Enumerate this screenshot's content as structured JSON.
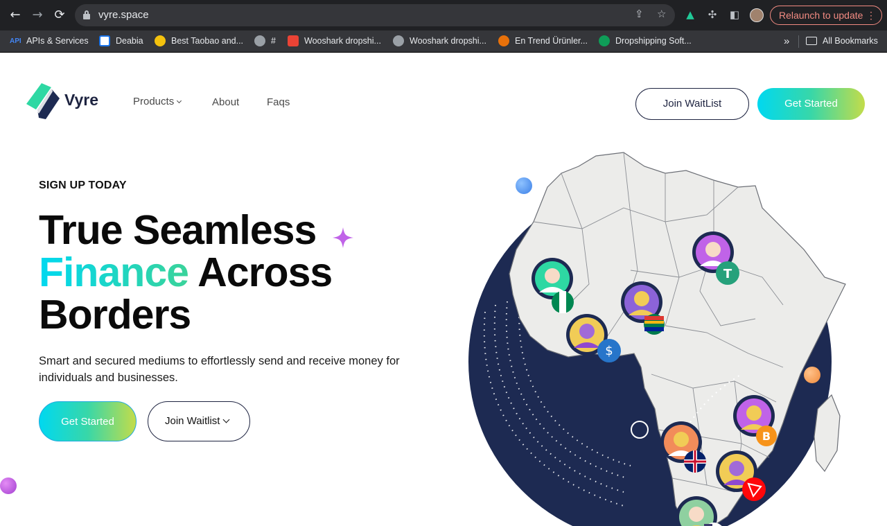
{
  "browser": {
    "url": "vyre.space",
    "relaunch_label": "Relaunch to update",
    "bookmarks": [
      {
        "label": "APIs & Services",
        "color": "#4285f4"
      },
      {
        "label": "Deabia",
        "color": "#ffffff"
      },
      {
        "label": "Best Taobao and...",
        "color": "#f4c20d"
      },
      {
        "label": "#",
        "color": "#9aa0a6"
      },
      {
        "label": "Wooshark dropshi...",
        "color": "#ea4335"
      },
      {
        "label": "Wooshark dropshi...",
        "color": "#9aa0a6"
      },
      {
        "label": "En Trend Ürünler...",
        "color": "#e8710a"
      },
      {
        "label": "Dropshipping Soft...",
        "color": "#0f9d58"
      }
    ],
    "overflow_label": "»",
    "all_bookmarks_label": "All Bookmarks"
  },
  "header": {
    "logo_text": "Vyre",
    "nav": {
      "products": "Products",
      "about": "About",
      "faqs": "Faqs"
    },
    "join_waitlist_label": "Join WaitList",
    "get_started_label": "Get Started"
  },
  "hero": {
    "eyebrow": "SIGN UP TODAY",
    "headline_line1": "True Seamless",
    "headline_accent": "Finance",
    "headline_line2_rest": " Across",
    "headline_line3": "Borders",
    "subtext": "Smart and secured mediums to effortlessly send and receive money for individuals and businesses.",
    "get_started_label": "Get Started",
    "join_waitlist_label": "Join Waitlist"
  },
  "colors": {
    "navy": "#1d2a52",
    "teal": "#00d8f0",
    "lime": "#c3dc4a",
    "land": "#ececea",
    "purple_accent": "#c063e8"
  },
  "icons": {
    "back": "arrow-left-icon",
    "forward": "arrow-right-icon",
    "reload": "reload-icon",
    "share": "share-icon",
    "star": "star-icon",
    "extension": "puzzle-icon",
    "sidepanel": "side-panel-icon",
    "folder": "folder-icon"
  }
}
